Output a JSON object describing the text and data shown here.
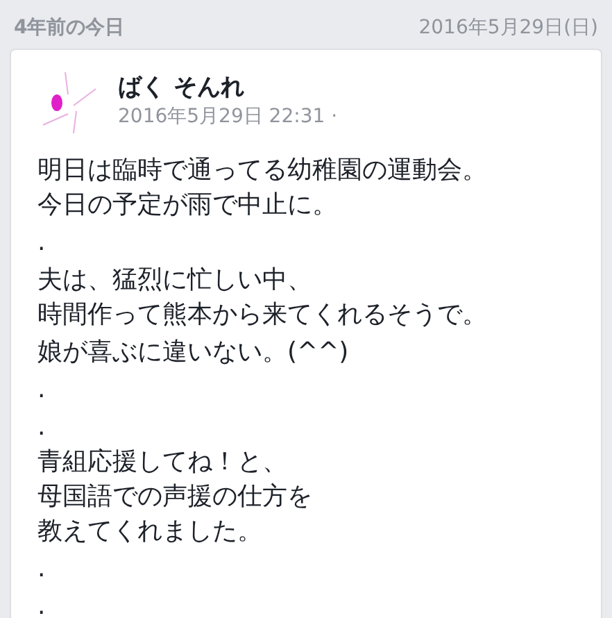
{
  "header": {
    "title": "4年前の今日",
    "date": "2016年5月29日(日)"
  },
  "post": {
    "author": "ばく そんれ",
    "timestamp": "2016年5月29日 22:31 ·",
    "paragraphs": [
      [
        "明日は臨時で通ってる幼稚園の運動会。",
        "今日の予定が雨で中止に。"
      ],
      [
        "."
      ],
      [
        "夫は、猛烈に忙しい中、",
        "時間作って熊本から来てくれるそうで。"
      ],
      [
        "娘が喜ぶに違いない。(^^)"
      ],
      [
        "."
      ],
      [
        ".",
        "青組応援してね！と、",
        "母国語での声援の仕方を",
        "教えてくれました。"
      ],
      [
        "."
      ],
      [
        "."
      ]
    ]
  }
}
